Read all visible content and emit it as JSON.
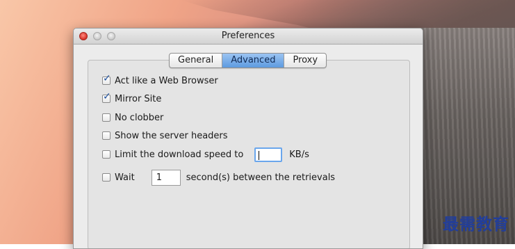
{
  "window": {
    "title": "Preferences"
  },
  "tabs": [
    {
      "label": "General",
      "active": false
    },
    {
      "label": "Advanced",
      "active": true
    },
    {
      "label": "Proxy",
      "active": false
    }
  ],
  "options": {
    "act_like_browser": {
      "label": "Act like a Web Browser",
      "checked": true
    },
    "mirror_site": {
      "label": "Mirror Site",
      "checked": true
    },
    "no_clobber": {
      "label": "No clobber",
      "checked": false
    },
    "show_headers": {
      "label": "Show the server headers",
      "checked": false
    },
    "limit_speed": {
      "label": "Limit the download speed to",
      "checked": false,
      "value": "",
      "unit": "KB/s"
    },
    "wait": {
      "label": "Wait",
      "checked": false,
      "value": "1",
      "suffix": "second(s) between the retrievals"
    }
  },
  "watermark": "最需教育",
  "colors": {
    "active_tab": "#5d9be0",
    "checkmark": "#1d4f9c",
    "close_button": "#d62f24",
    "watermark": "#223e9a"
  }
}
